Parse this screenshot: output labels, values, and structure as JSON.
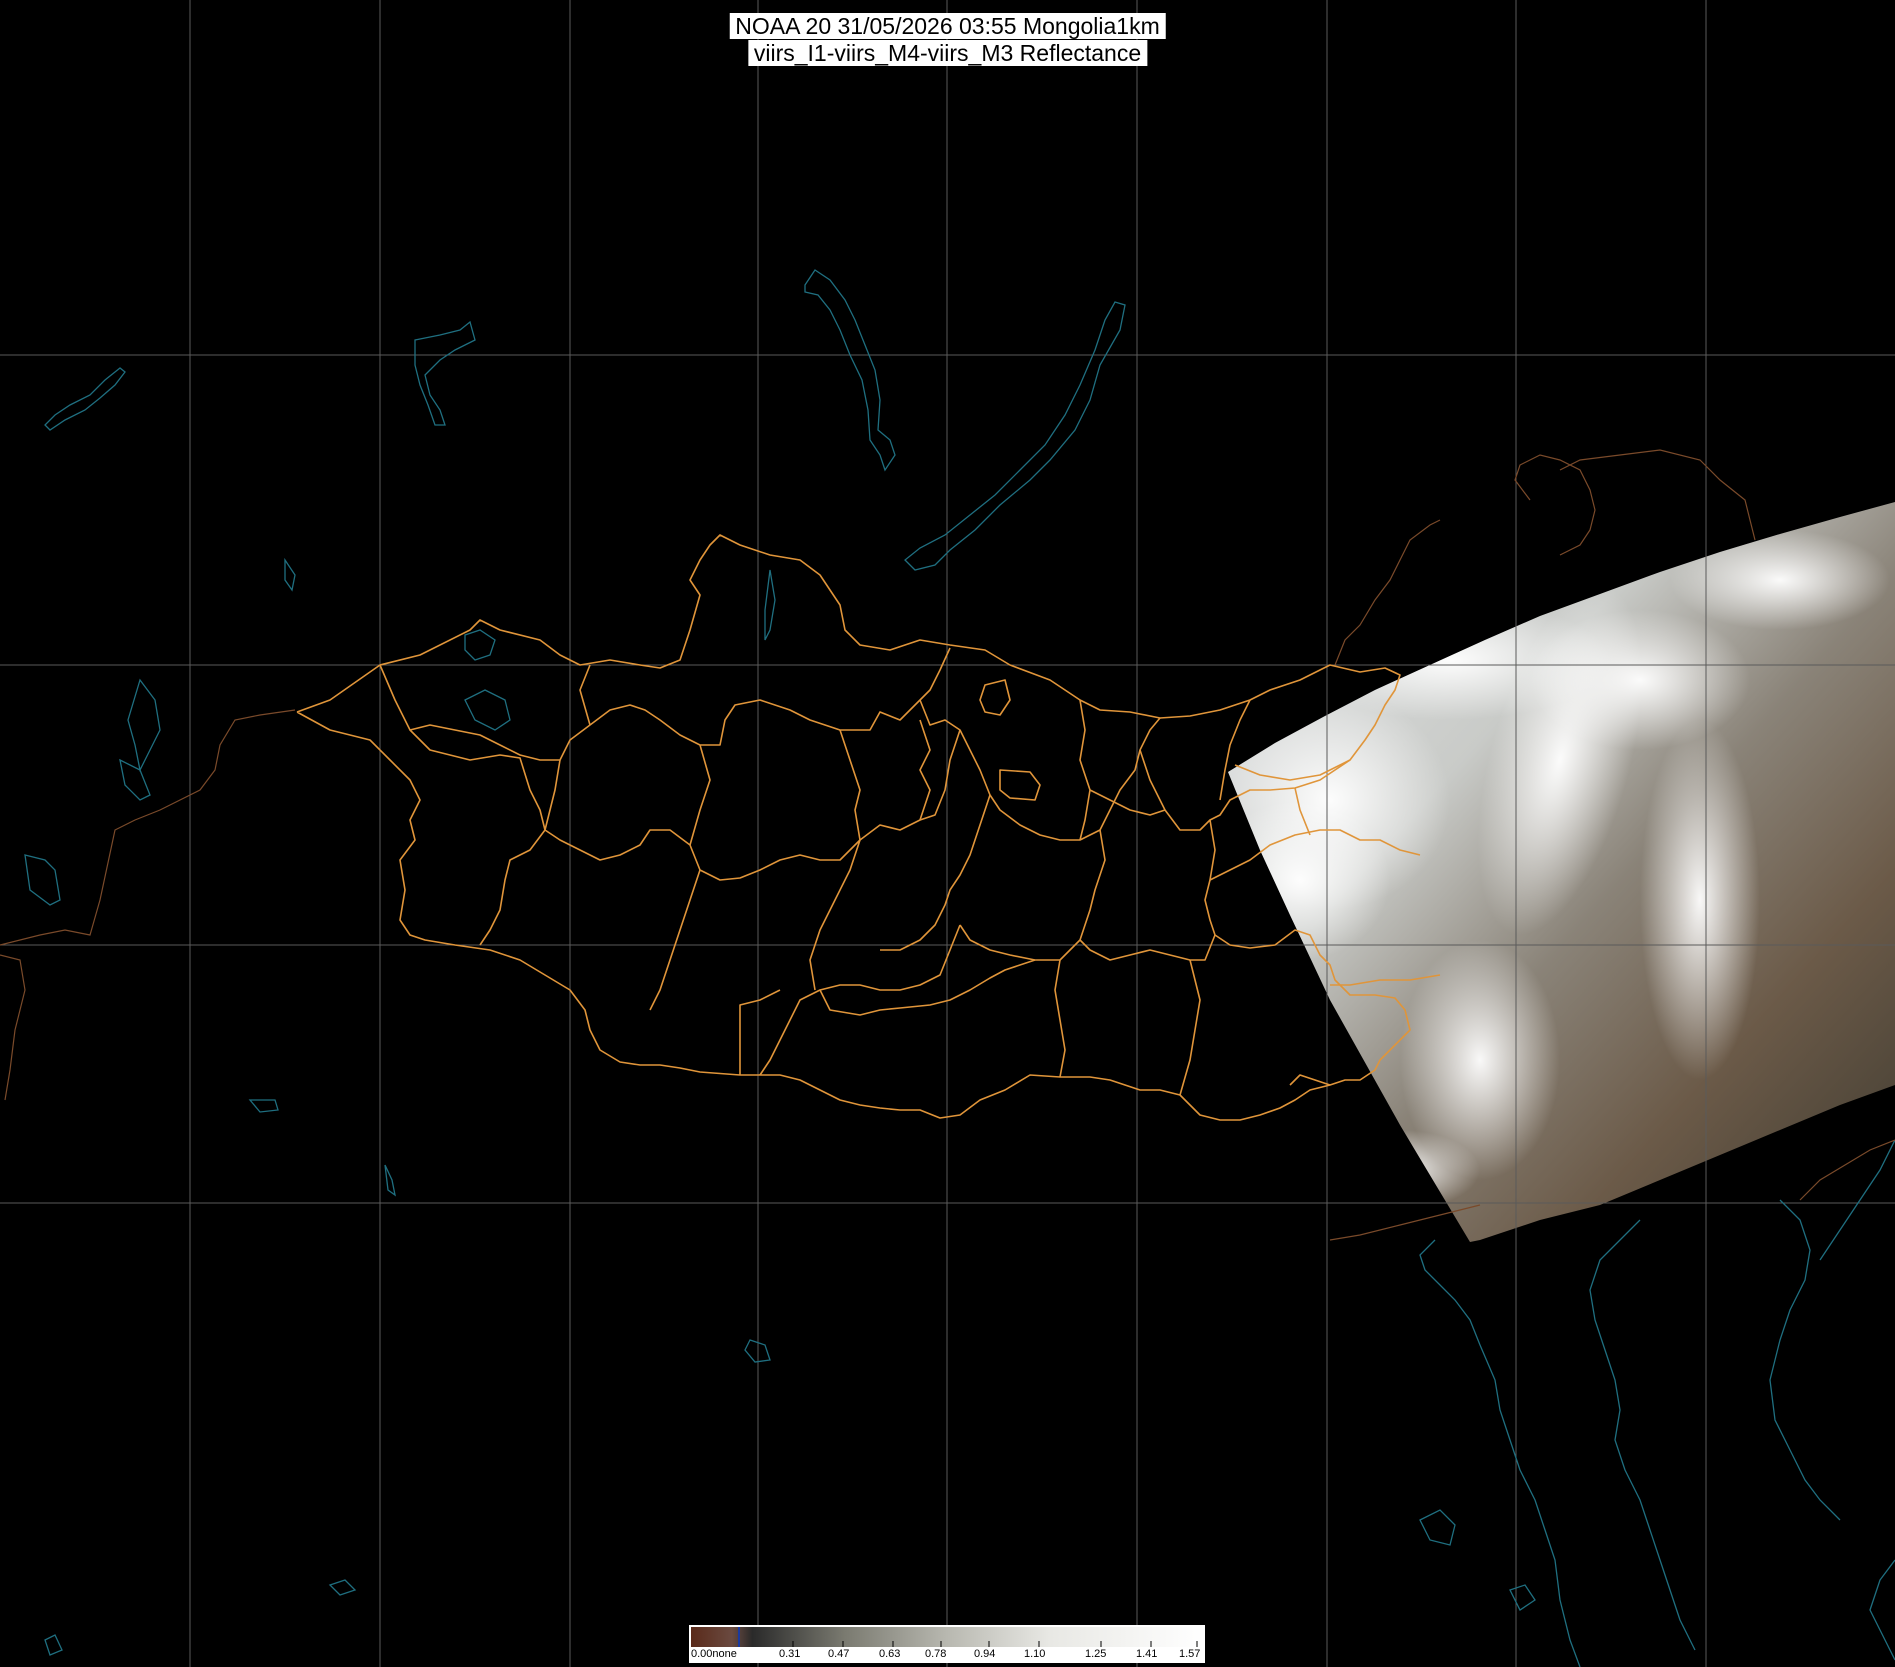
{
  "title": {
    "line1": "NOAA 20 31/05/2026 03:55 Mongolia1km",
    "line2": "viirs_I1-viirs_M4-viirs_M3 Reflectance"
  },
  "colors": {
    "background": "#000000",
    "graticule": "#5a5a5a",
    "province_borders": "#e0953a",
    "coast_lakes": "#1f6f80",
    "country_borders": "#7a4a2a"
  },
  "colorbar": {
    "no_data_label": "0.00none",
    "tick_labels": [
      "0.31",
      "0.47",
      "0.63",
      "0.78",
      "0.94",
      "1.10",
      "1.25",
      "1.41",
      "1.57"
    ]
  }
}
